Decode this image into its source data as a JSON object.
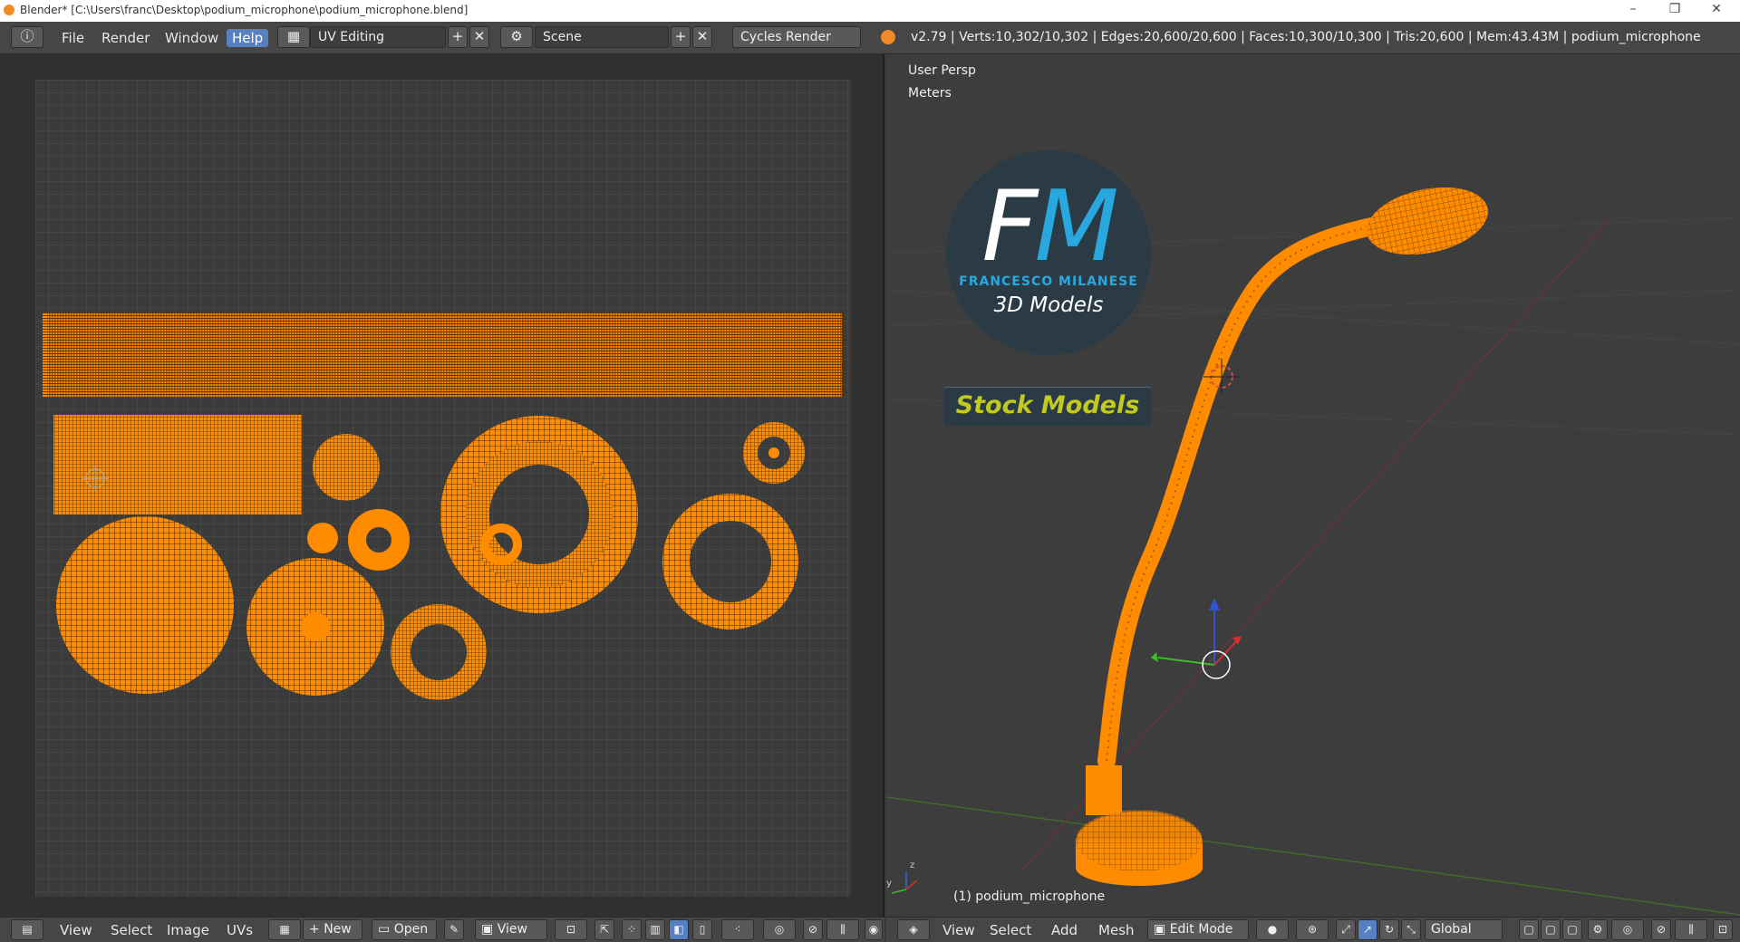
{
  "window": {
    "title": "Blender* [C:\\Users\\franc\\Desktop\\podium_microphone\\podium_microphone.blend]",
    "minimize": "–",
    "restore": "❐",
    "close": "✕"
  },
  "topbar": {
    "menus": [
      "File",
      "Render",
      "Window",
      "Help"
    ],
    "active_menu": "Help",
    "layout": "UV Editing",
    "scene": "Scene",
    "engine": "Cycles Render",
    "stats": "v2.79 | Verts:10,302/10,302 | Edges:20,600/20,600 | Faces:10,300/10,300 | Tris:20,600 | Mem:43.43M | podium_microphone"
  },
  "uv_editor": {
    "menus": [
      "View",
      "Select",
      "Image",
      "UVs"
    ],
    "new_label": "New",
    "open_label": "Open",
    "view_label": "View"
  },
  "viewport": {
    "view_name": "User Persp",
    "units": "Meters",
    "object_label": "(1) podium_microphone",
    "menus": [
      "View",
      "Select",
      "Add",
      "Mesh"
    ],
    "mode": "Edit Mode",
    "orientation": "Global"
  },
  "watermark": {
    "initial_f": "F",
    "initial_m": "M",
    "name": "FRANCESCO MILANESE",
    "tagline": "3D Models",
    "badge": "Stock Models"
  },
  "colors": {
    "mesh": "#ff8c00",
    "accent": "#5680c2",
    "logo_blue": "#29a8e0",
    "logo_yellow": "#c2c921"
  }
}
